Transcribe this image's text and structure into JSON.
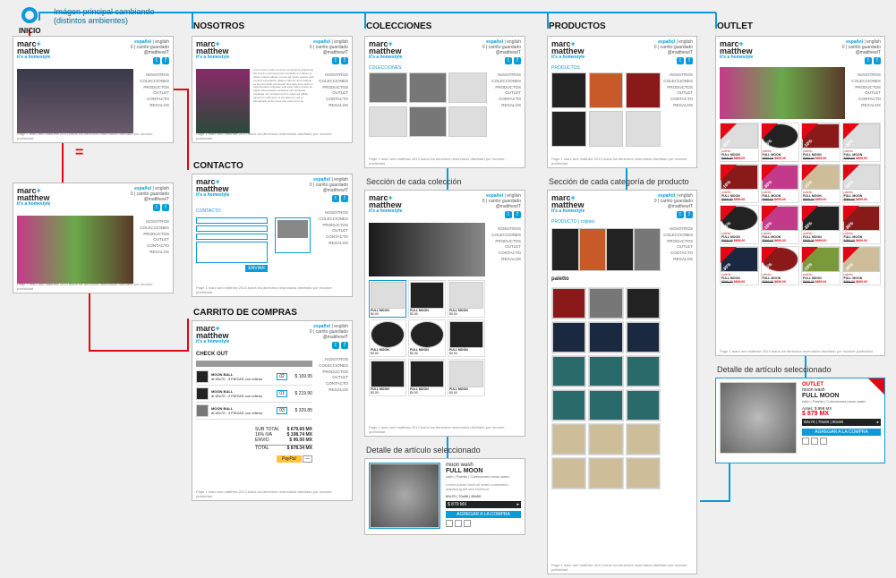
{
  "nodes": {
    "inicio": {
      "label": "INICIO",
      "note": "Imágen principal cambiando\n(distintos ambientes)"
    },
    "nosotros": {
      "label": "NOSOTROS"
    },
    "colecciones": {
      "label": "COLECCIONES"
    },
    "productos": {
      "label": "PRODUCTOS"
    },
    "outlet": {
      "label": "OUTLET"
    },
    "contacto": {
      "label": "CONTACTO"
    },
    "carrito": {
      "label": "CARRITO DE COMPRAS"
    },
    "seccion_coleccion": {
      "label": "Sección de cada colección"
    },
    "seccion_categoria": {
      "label": "Sección de cada categoría de producto"
    },
    "detalle_col": {
      "label": "Detalle de artículo seleccionado"
    },
    "detalle_out": {
      "label": "Detalle de artículo seleccionado"
    }
  },
  "brand": {
    "line1": "marc",
    "plus": "+",
    "line2": "matthew",
    "tagline": "it's a homestyle"
  },
  "header": {
    "left": "español",
    "right": "english",
    "cart": "0 | carrito guardado",
    "twit": "@matthewIT"
  },
  "menu": [
    "NOSOTROS",
    "COLECCIONES",
    "PRODUCTOS",
    "OUTLET",
    "CONTACTO",
    "REGALOS"
  ],
  "footer": "Page 1     marc and matthew  2013 todos los derechos reservados diseñado por mcclure publicidad",
  "cart": {
    "title": "CHECK OUT",
    "rows": [
      {
        "name": "MOON BALL",
        "sub": "dt 60x70 - 3 PIEZAS con relleno",
        "q": "02",
        "p": "$ 109.95"
      },
      {
        "name": "MOON BALL",
        "sub": "dt 60x70 - 2 PIEZAS con relleno",
        "q": "01",
        "p": "$ 219.90"
      },
      {
        "name": "MOON BALL",
        "sub": "dt 60x70 - 3 PIEZAS con relleno",
        "q": "03",
        "p": "$ 329.85"
      }
    ],
    "subtotal_l": "SUB TOTAL",
    "subtotal_v": "$ 679.60 MX",
    "iva_l": "16% IVA",
    "iva_v": "$ 108.74 MX",
    "envio_l": "ENVIO",
    "envio_v": "$ 90.00 MX",
    "total_l": "TOTAL",
    "total_v": "$ 878.34 MX",
    "pay": "PayPal"
  },
  "productos": {
    "header": "PRODUCTOS"
  },
  "colecciones": {
    "header": "COLECCIONES"
  },
  "paletto": {
    "label": "paletto"
  },
  "detalle": {
    "brand": "moon wash",
    "name": "FULL MOON",
    "cat": "cojín | Paletto | Colecciones moon wash",
    "sizes": "60x70 | 70x80 | 80x90",
    "price_before": "Antes:  $ 999 MX",
    "price_now": "$ 879 MX",
    "btn": "AGREGAR A LA COMPRA",
    "discount": "-30%",
    "outlet_tag": "OUTLET"
  },
  "outlet_cell": {
    "tag": "paletto",
    "name": "FULL MOON",
    "p1": "$999.00",
    "p2": "$699.00",
    "d1": "-30%",
    "d2": "-15%",
    "d3": "-10%"
  },
  "coll_cell": {
    "name": "FULL MOON",
    "p": "$0.00"
  }
}
